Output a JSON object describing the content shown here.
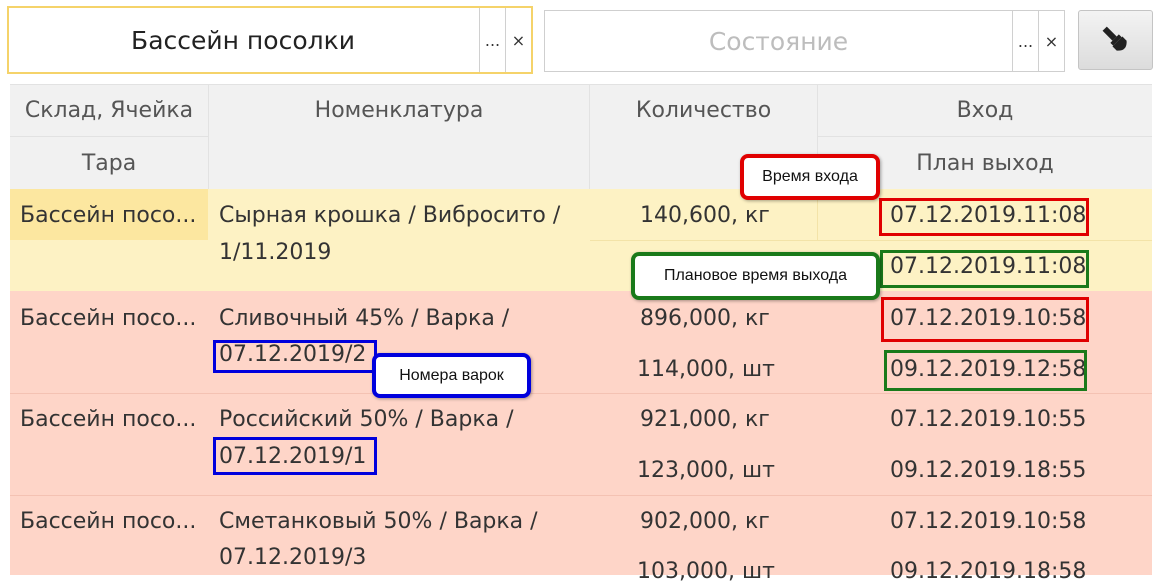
{
  "filters": {
    "warehouse_value": "Бассейн посолки",
    "state_placeholder": "Состояние",
    "ellipsis": "...",
    "clear": "×"
  },
  "toolbar": {
    "brush_icon": "paint-brush-icon"
  },
  "table": {
    "headers": {
      "col1_top": "Склад, Ячейка",
      "col1_bottom": "Тара",
      "col2": "Номенклатура",
      "col3": "Количество",
      "col4_top": "Вход",
      "col4_bottom": "План выход"
    },
    "rows": [
      {
        "warehouse": "Бассейн посо...",
        "nomen_line1": "Сырная крошка / Вибросито /",
        "nomen_line2": "1/11.2019",
        "qty1": "140,600, кг",
        "qty2": "",
        "date_in": "07.12.2019.11:08",
        "date_out": "07.12.2019.11:08"
      },
      {
        "warehouse": "Бассейн посо...",
        "nomen_line1": "Сливочный 45% / Варка /",
        "nomen_line2": "07.12.2019/2",
        "qty1": "896,000, кг",
        "qty2": "114,000, шт",
        "date_in": "07.12.2019.10:58",
        "date_out": "09.12.2019.12:58"
      },
      {
        "warehouse": "Бассейн посо...",
        "nomen_line1": "Российский 50% / Варка /",
        "nomen_line2": "07.12.2019/1",
        "qty1": "921,000, кг",
        "qty2": "123,000, шт",
        "date_in": "07.12.2019.10:55",
        "date_out": "09.12.2019.18:55"
      },
      {
        "warehouse": "Бассейн посо...",
        "nomen_line1": "Сметанковый 50% / Варка /",
        "nomen_line2": "07.12.2019/3",
        "qty1": "902,000, кг",
        "qty2": "103,000, шт",
        "date_in": "07.12.2019.10:58",
        "date_out": "09.12.2019.18:58"
      }
    ]
  },
  "annotations": {
    "entry_time": "Время входа",
    "planned_exit": "Плановое время выхода",
    "batch_numbers": "Номера варок"
  },
  "colors": {
    "selected_row": "#fdf2c4",
    "selected_cell": "#fce7a0",
    "other_rows": "#fed5c8",
    "focus_border": "#f5d36a"
  }
}
